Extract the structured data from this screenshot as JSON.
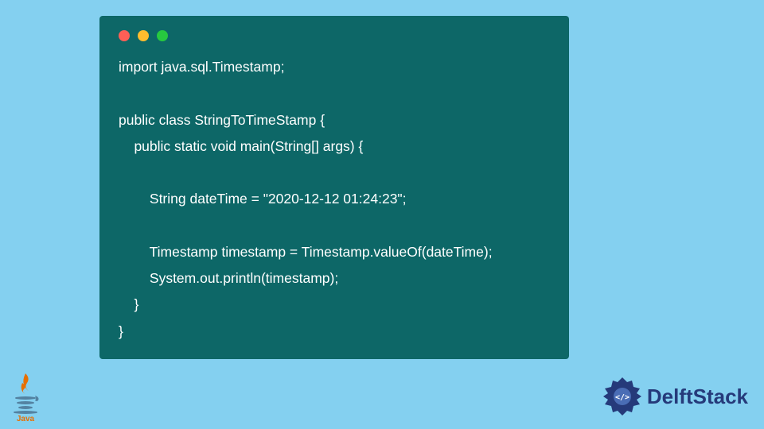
{
  "code": {
    "lines": [
      "import java.sql.Timestamp;",
      "",
      "public class StringToTimeStamp {",
      "    public static void main(String[] args) {",
      "",
      "        String dateTime = \"2020-12-12 01:24:23\";",
      "",
      "        Timestamp timestamp = Timestamp.valueOf(dateTime);",
      "        System.out.println(timestamp);",
      "    }",
      "}"
    ]
  },
  "brand": {
    "name": "DelftStack"
  },
  "java_logo": {
    "label": "Java"
  }
}
